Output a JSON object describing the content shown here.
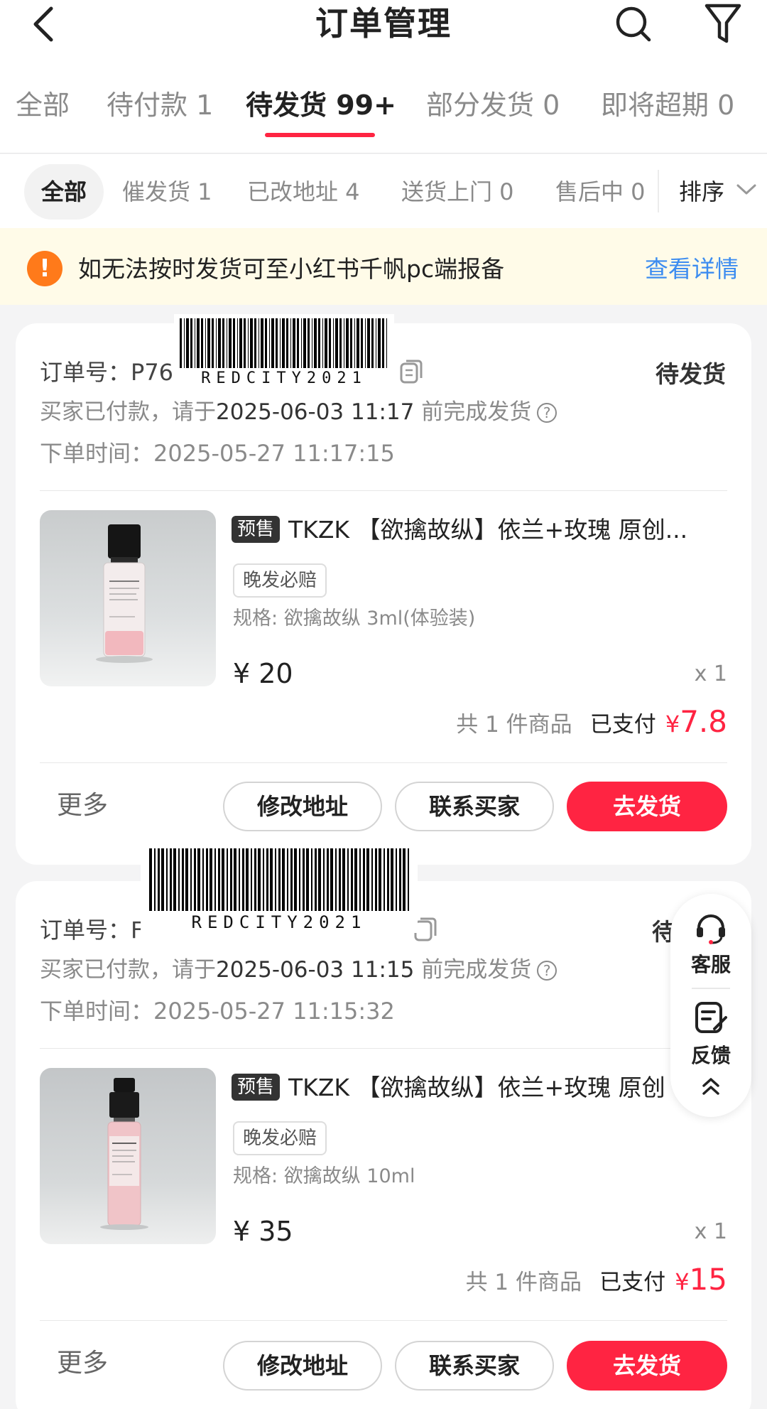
{
  "header": {
    "title": "订单管理"
  },
  "tabs": [
    {
      "label": "全部"
    },
    {
      "label": "待付款 1"
    },
    {
      "label": "待发货 99+"
    },
    {
      "label": "部分发货 0"
    },
    {
      "label": "即将超期 0"
    }
  ],
  "subtabs": [
    {
      "label": "全部"
    },
    {
      "label": "催发货 1"
    },
    {
      "label": "已改地址 4"
    },
    {
      "label": "送货上门 0"
    },
    {
      "label": "售后中 0"
    }
  ],
  "sort_label": "排序",
  "notice": {
    "text": "如无法按时发货可至小红书千帆pc端报备",
    "link": "查看详情"
  },
  "watermark_text": "REDCITY2021",
  "float": {
    "service_label": "客服",
    "feedback_label": "反馈"
  },
  "orders": [
    {
      "order_no_label": "订单号：",
      "order_no_visible_left": "P76",
      "status": "待发货",
      "deadline_prefix": "买家已付款，请于",
      "deadline": "2025-06-03 11:17",
      "deadline_suffix": "前完成发货",
      "order_time_label": "下单时间：",
      "order_time": "2025-05-27 11:17:15",
      "presale_tag": "预售",
      "product_title": "TKZK 【欲擒故纵】依兰+玫瑰 原创...",
      "guarantee_tag": "晚发必赔",
      "spec_label": "规格:",
      "spec": "欲擒故纵 3ml(体验装)",
      "price": "¥ 20",
      "qty": "x 1",
      "summary_count": "共 1 件商品",
      "paid_label": "已支付",
      "paid_currency": "¥",
      "paid_amount": "7.8",
      "more_label": "更多",
      "btn_change_address": "修改地址",
      "btn_contact": "联系买家",
      "btn_ship": "去发货"
    },
    {
      "order_no_label": "订单号：",
      "order_no_visible_left": "F",
      "status": "待发货",
      "deadline_prefix": "买家已付款，请于",
      "deadline": "2025-06-03 11:15",
      "deadline_suffix": "前完成发货",
      "order_time_label": "下单时间：",
      "order_time": "2025-05-27 11:15:32",
      "presale_tag": "预售",
      "product_title": "TKZK 【欲擒故纵】依兰+玫瑰 原创",
      "guarantee_tag": "晚发必赔",
      "spec_label": "规格:",
      "spec": "欲擒故纵 10ml",
      "price": "¥ 35",
      "qty": "x 1",
      "summary_count": "共 1 件商品",
      "paid_label": "已支付",
      "paid_currency": "¥",
      "paid_amount": "15",
      "more_label": "更多",
      "btn_change_address": "修改地址",
      "btn_contact": "联系买家",
      "btn_ship": "去发货"
    }
  ],
  "colors": {
    "accent": "#ff2442",
    "link": "#3c8cf0",
    "notice_bg": "#fffbe8",
    "warn": "#ff7a1a"
  }
}
